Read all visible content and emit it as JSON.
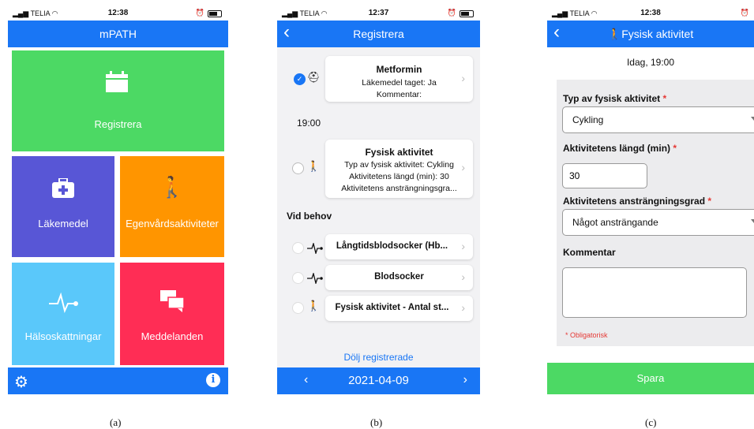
{
  "status": {
    "carrier": "TELIA"
  },
  "phone_a": {
    "time": "12:38",
    "title": "mPATH",
    "tiles": [
      {
        "label": "Registrera",
        "icon": "calendar-icon"
      },
      {
        "label": "Läkemedel",
        "icon": "medkit-icon"
      },
      {
        "label": "Egenvårdsaktiviteter",
        "icon": "walking-icon"
      },
      {
        "label": "Hälsoskattningar",
        "icon": "pulse-icon"
      },
      {
        "label": "Meddelanden",
        "icon": "chat-icon"
      }
    ],
    "colors": {
      "registrera": "#4cd964",
      "lakemedel": "#5856d6",
      "egenvard": "#ff9500",
      "halsoskattningar": "#5ac8fa",
      "meddelanden": "#ff2d55",
      "nav": "#1976f5"
    }
  },
  "phone_b": {
    "time": "12:37",
    "title": "Registrera",
    "entries": [
      {
        "title": "Metformin",
        "lines": [
          "Läkemedel taget: Ja",
          "Kommentar:"
        ],
        "checked": true
      },
      {
        "title": "Fysisk aktivitet",
        "lines": [
          "Typ av fysisk aktivitet: Cykling",
          "Aktivitetens längd (min): 30",
          "Aktivitetens ansträngningsgra..."
        ],
        "checked": false
      }
    ],
    "time_label": "19:00",
    "section_label": "Vid behov",
    "on_demand": [
      {
        "title": "Långtidsblodsocker (Hb..."
      },
      {
        "title": "Blodsocker"
      },
      {
        "title": "Fysisk aktivitet - Antal st..."
      }
    ],
    "hide_label": "Dölj registrerade",
    "date": "2021-04-09"
  },
  "phone_c": {
    "time": "12:38",
    "title": "Fysisk aktivitet",
    "subtitle": "Idag, 19:00",
    "fields": {
      "type_label": "Typ av fysisk aktivitet",
      "type_value": "Cykling",
      "length_label": "Aktivitetens längd (min)",
      "length_value": "30",
      "effort_label": "Aktivitetens ansträngningsgrad",
      "effort_value": "Något ansträngande",
      "comment_label": "Kommentar",
      "comment_value": ""
    },
    "required_marker": "*",
    "required_note": "* Obligatorisk",
    "save_label": "Spara"
  },
  "captions": {
    "a": "(a)",
    "b": "(b)",
    "c": "(c)"
  }
}
